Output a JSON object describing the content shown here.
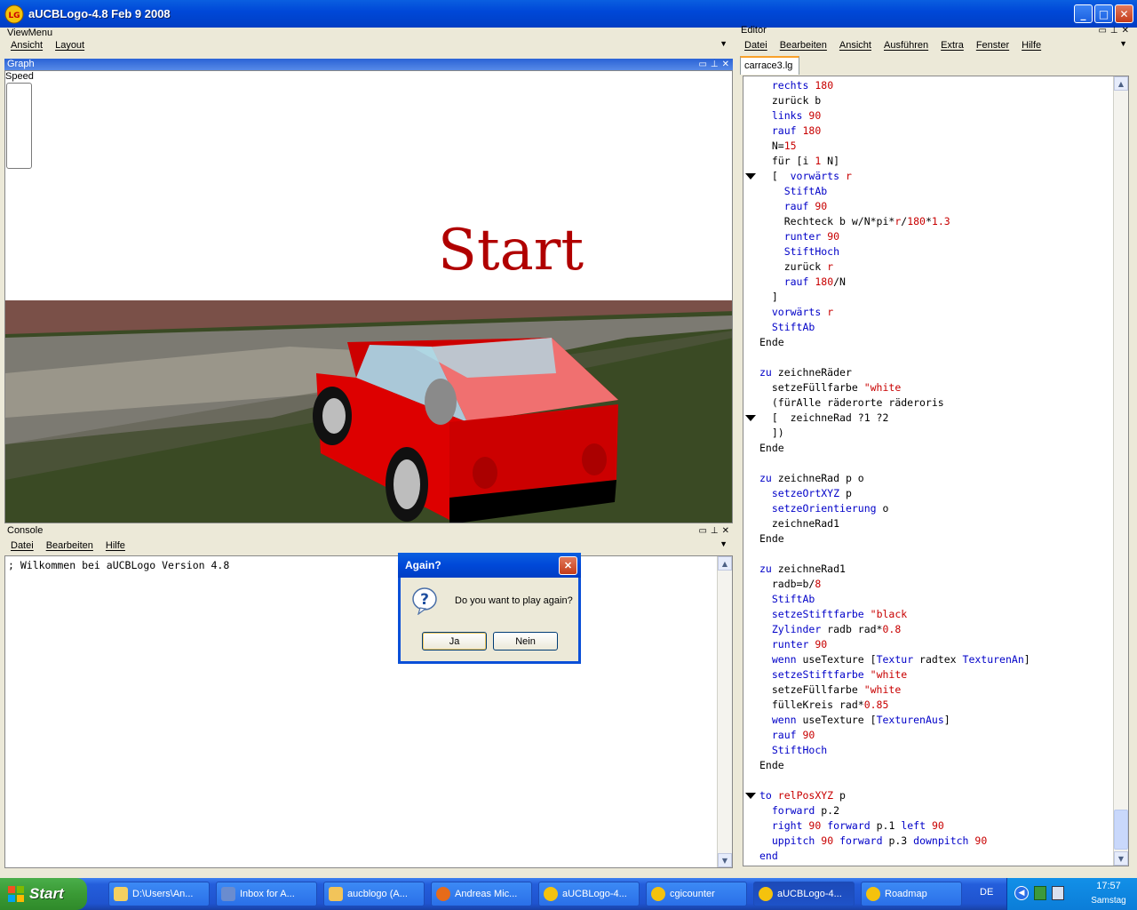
{
  "window": {
    "title": "aUCBLogo-4.8 Feb  9 2008"
  },
  "viewmenu": {
    "title": "ViewMenu",
    "items": [
      "Ansicht",
      "Layout"
    ]
  },
  "graph": {
    "title": "Graph",
    "speed_label": "Speed",
    "start_text": "Start"
  },
  "console": {
    "title": "Console",
    "menu": [
      "Datei",
      "Bearbeiten",
      "Hilfe"
    ],
    "text": "; Wilkommen bei aUCBLogo Version 4.8"
  },
  "editor": {
    "title": "Editor",
    "menu": [
      "Datei",
      "Bearbeiten",
      "Ansicht",
      "Ausführen",
      "Extra",
      "Fenster",
      "Hilfe"
    ],
    "tab": "carrace3.lg",
    "lines": [
      "  rechts 180",
      "  zurück b",
      "  links 90",
      "  rauf 180",
      "  N=15",
      "  für [i 1 N]",
      "  [  vorwärts r",
      "    StiftAb",
      "    rauf 90",
      "    Rechteck b w/N*pi*r/180*1.3",
      "    runter 90",
      "    StiftHoch",
      "    zurück r",
      "    rauf 180/N",
      "  ]",
      "  vorwärts r",
      "  StiftAb",
      "Ende",
      "",
      "zu zeichneRäder",
      "  setzeFüllfarbe \"white",
      "  (fürAlle räderorte räderoris",
      "  [  zeichneRad ?1 ?2",
      "  ])",
      "Ende",
      "",
      "zu zeichneRad p o",
      "  setzeOrtXYZ p",
      "  setzeOrientierung o",
      "  zeichneRad1",
      "Ende",
      "",
      "zu zeichneRad1",
      "  radb=b/8",
      "  StiftAb",
      "  setzeStiftfarbe \"black",
      "  Zylinder radb rad*0.8",
      "  runter 90",
      "  wenn useTexture [Textur radtex TexturenAn]",
      "  setzeStiftfarbe \"white",
      "  setzeFüllfarbe \"white",
      "  fülleKreis rad*0.85",
      "  wenn useTexture [TexturenAus]",
      "  rauf 90",
      "  StiftHoch",
      "Ende",
      "",
      "to relPosXYZ p",
      "  forward p.2",
      "  right 90 forward p.1 left 90",
      "  uppitch 90 forward p.3 downpitch 90",
      "end"
    ]
  },
  "dialog": {
    "title": "Again?",
    "message": "Do you want to play again?",
    "yes": "Ja",
    "no": "Nein"
  },
  "taskbar": {
    "start": "Start",
    "tasks": [
      "D:\\Users\\An...",
      "Inbox for A...",
      "aucblogo (A...",
      "Andreas Mic...",
      "aUCBLogo-4...",
      "cgicounter",
      "aUCBLogo-4...",
      "Roadmap"
    ],
    "lang": "DE",
    "time": "17:57",
    "day": "Samstag"
  }
}
